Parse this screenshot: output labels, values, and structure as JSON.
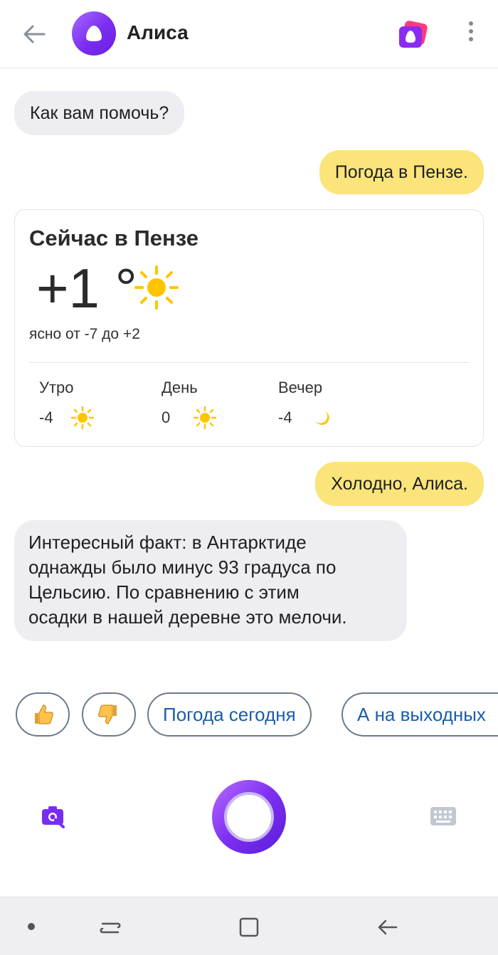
{
  "header": {
    "title": "Алиса",
    "accent_color": "#7a2df0"
  },
  "messages": {
    "alice_greeting": "Как вам помочь?",
    "user_weather": "Погода в Пензе.",
    "user_cold": "Холодно, Алиса.",
    "alice_fact": [
      "Интересный факт: в Антарктиде",
      "однажды было минус 93 градуса по",
      "Цельсию. По сравнению с этим",
      "осадки в нашей деревне это мелочи."
    ]
  },
  "weather": {
    "title": "Сейчас в Пензе",
    "current_temp": "+1 °",
    "condition": "ясно от -7 до +2",
    "parts": [
      {
        "label": "Утро",
        "temp": "-4",
        "icon": "sun-icon"
      },
      {
        "label": "День",
        "temp": "0",
        "icon": "sun-icon"
      },
      {
        "label": "Вечер",
        "temp": "-4",
        "icon": "moon-icon"
      }
    ]
  },
  "suggestions": {
    "like_icon": "thumbs-up-icon",
    "dislike_icon": "thumbs-down-icon",
    "chip_today": "Погода сегодня",
    "chip_weekend": "А на выходных"
  },
  "colors": {
    "user_bubble": "#fbe57a",
    "alice_bubble": "#eeeef2",
    "chip_text": "#1a5da8"
  }
}
